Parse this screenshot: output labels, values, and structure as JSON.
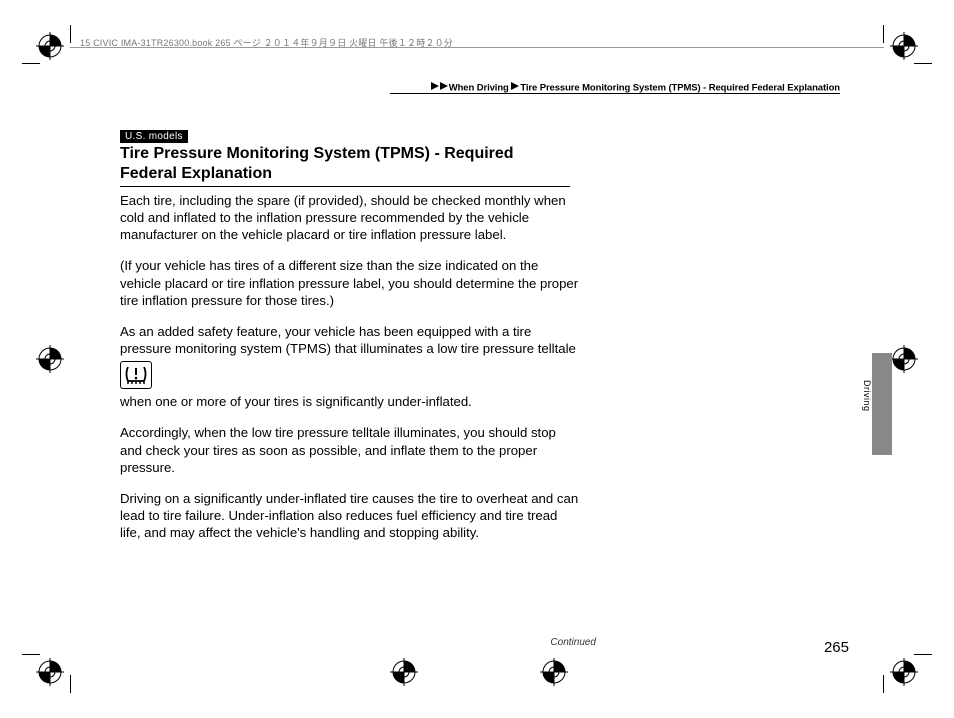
{
  "header": {
    "print_info": "15 CIVIC IMA-31TR26300.book  265 ページ  ２０１４年９月９日  火曜日  午後１２時２０分"
  },
  "breadcrumb": {
    "section1": "When Driving",
    "section2": "Tire Pressure Monitoring System (TPMS) - Required Federal Explanation"
  },
  "badge": "U.S. models",
  "title": "Tire Pressure Monitoring System (TPMS) - Required Federal Explanation",
  "paragraphs": {
    "p1": "Each tire, including the spare (if provided), should be checked monthly when cold and inflated to the inflation pressure recommended by the vehicle manufacturer on the vehicle placard or tire inflation pressure label.",
    "p2": "(If your vehicle has tires of a different size than the size indicated on the vehicle placard or tire inflation pressure label, you should determine the proper tire inflation pressure for those tires.)",
    "p3": "As an added safety feature, your vehicle has been equipped with a tire pressure monitoring system (TPMS) that illuminates a low tire pressure telltale",
    "p4": "when one or more of your tires is significantly under-inflated.",
    "p5": "Accordingly, when the low tire pressure telltale illuminates, you should stop and check your tires as soon as possible, and inflate them to the proper pressure.",
    "p6": "Driving on a significantly under-inflated tire causes the tire to overheat and can lead to tire failure. Under-inflation also reduces fuel efficiency and tire tread life, and may affect the vehicle's handling and stopping ability."
  },
  "side_tab": "Driving",
  "footer": {
    "continued": "Continued",
    "page": "265"
  }
}
